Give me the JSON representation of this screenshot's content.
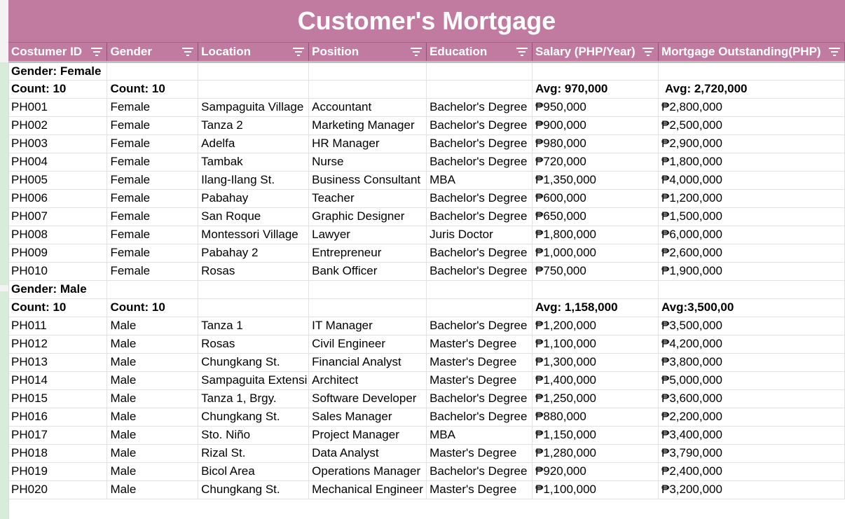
{
  "title": "Customer's Mortgage",
  "headers": [
    "Costumer ID",
    "Gender",
    "Location",
    "Position",
    "Education",
    "Salary (PHP/Year)",
    "Mortgage Outstanding(PHP)"
  ],
  "groups": [
    {
      "label": "Gender: Female",
      "count_id": "Count: 10",
      "count_gender": "Count: 10",
      "avg_salary": "Avg: 970,000",
      "avg_mortgage": "Avg: 2,720,000",
      "rows": [
        [
          "PH001",
          "Female",
          "Sampaguita Village",
          "Accountant",
          "Bachelor's Degree",
          "₱950,000",
          "₱2,800,000"
        ],
        [
          "PH002",
          "Female",
          "Tanza 2",
          "Marketing Manager",
          "Bachelor's Degree",
          "₱900,000",
          "₱2,500,000"
        ],
        [
          "PH003",
          "Female",
          "Adelfa",
          "HR Manager",
          "Bachelor's Degree",
          "₱980,000",
          "₱2,900,000"
        ],
        [
          "PH004",
          "Female",
          "Tambak",
          "Nurse",
          "Bachelor's Degree",
          "₱720,000",
          "₱1,800,000"
        ],
        [
          "PH005",
          "Female",
          "Ilang-Ilang St.",
          "Business Consultant",
          "MBA",
          "₱1,350,000",
          "₱4,000,000"
        ],
        [
          "PH006",
          "Female",
          "Pabahay",
          "Teacher",
          "Bachelor's Degree",
          "₱600,000",
          "₱1,200,000"
        ],
        [
          "PH007",
          "Female",
          "San Roque",
          "Graphic Designer",
          "Bachelor's Degree",
          "₱650,000",
          "₱1,500,000"
        ],
        [
          "PH008",
          "Female",
          "Montessori Village",
          "Lawyer",
          "Juris Doctor",
          "₱1,800,000",
          "₱6,000,000"
        ],
        [
          "PH009",
          "Female",
          "Pabahay 2",
          "Entrepreneur",
          "Bachelor's Degree",
          "₱1,000,000",
          "₱2,600,000"
        ],
        [
          "PH010",
          "Female",
          "Rosas",
          "Bank Officer",
          "Bachelor's Degree",
          "₱750,000",
          "₱1,900,000"
        ]
      ]
    },
    {
      "label": "Gender: Male",
      "count_id": "Count: 10",
      "count_gender": "Count: 10",
      "avg_salary": "Avg: 1,158,000",
      "avg_mortgage": "Avg:3,500,00",
      "rows": [
        [
          "PH011",
          "Male",
          "Tanza 1",
          "IT Manager",
          "Bachelor's Degree",
          "₱1,200,000",
          "₱3,500,000"
        ],
        [
          "PH012",
          "Male",
          "Rosas",
          "Civil Engineer",
          "Master's Degree",
          "₱1,100,000",
          "₱4,200,000"
        ],
        [
          "PH013",
          "Male",
          "Chungkang St.",
          "Financial Analyst",
          "Master's Degree",
          "₱1,300,000",
          "₱3,800,000"
        ],
        [
          "PH014",
          "Male",
          "Sampaguita Extensi",
          "Architect",
          "Master's Degree",
          "₱1,400,000",
          "₱5,000,000"
        ],
        [
          "PH015",
          "Male",
          "Tanza 1, Brgy.",
          "Software Developer",
          "Bachelor's Degree",
          "₱1,250,000",
          "₱3,600,000"
        ],
        [
          "PH016",
          "Male",
          "Chungkang St.",
          "Sales Manager",
          "Bachelor's Degree",
          "₱880,000",
          "₱2,200,000"
        ],
        [
          "PH017",
          "Male",
          "Sto. Niño",
          "Project Manager",
          "MBA",
          "₱1,150,000",
          "₱3,400,000"
        ],
        [
          "PH018",
          "Male",
          "Rizal St.",
          "Data Analyst",
          "Master's Degree",
          "₱1,280,000",
          "₱3,790,000"
        ],
        [
          "PH019",
          "Male",
          "Bicol Area",
          "Operations Manager",
          "Bachelor's Degree",
          "₱920,000",
          "₱2,400,000"
        ],
        [
          "PH020",
          "Male",
          "Chungkang St.",
          "Mechanical Engineer",
          "Master's Degree",
          "₱1,100,000",
          "₱3,200,000"
        ]
      ]
    }
  ],
  "colors": {
    "header_bg": "#c27ba0",
    "header_text": "#ffffff"
  }
}
